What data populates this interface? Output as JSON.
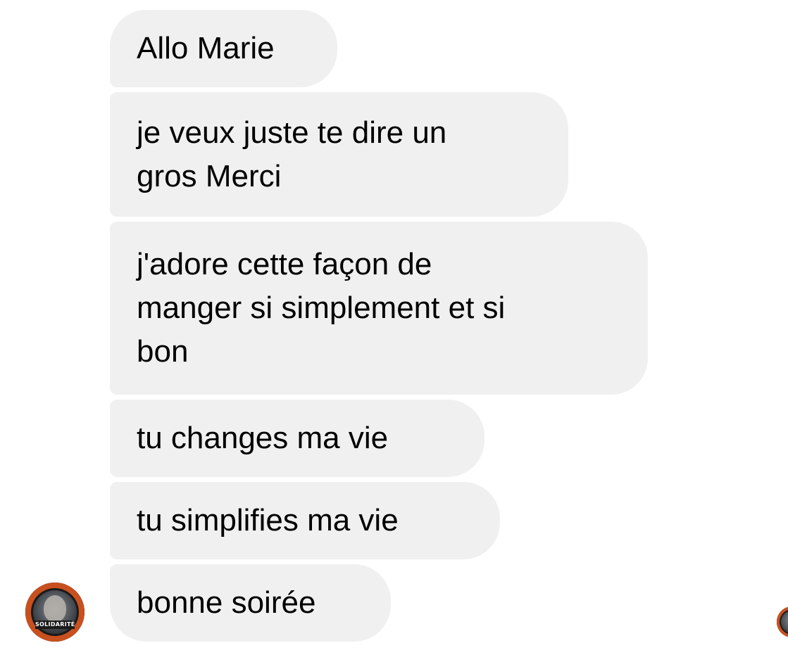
{
  "conversation": {
    "messages": [
      {
        "text": "Allo Marie"
      },
      {
        "text": "je veux juste te dire un\ngros Merci"
      },
      {
        "text": "j'adore cette façon de\nmanger si simplement et si\nbon"
      },
      {
        "text": "tu changes ma vie"
      },
      {
        "text": "tu simplifies ma vie"
      },
      {
        "text": "bonne soirée"
      }
    ]
  },
  "sender": {
    "avatar_badge_text": "SOLIDARITÉ",
    "avatar_icon": "profile-avatar-icon"
  },
  "colors": {
    "bubble_background": "#f0f0f0",
    "text": "#000000",
    "page_background": "#ffffff",
    "avatar_ring": "#c8501e"
  }
}
